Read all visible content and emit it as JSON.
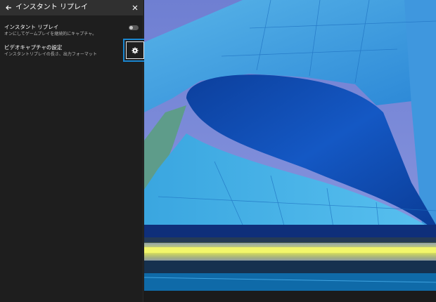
{
  "header": {
    "back_icon": "back-arrow-icon",
    "title": "インスタント リプレイ",
    "close_icon": "close-icon"
  },
  "settings": {
    "instant_replay": {
      "label": "インスタント リプレイ",
      "description": "オンにしてゲームプレイを継続的にキャプチャ。",
      "toggle_on": false
    },
    "video_capture": {
      "label": "ビデオキャプチャの設定",
      "description": "インスタントリプレイの長さ、出力フォーマット",
      "icon": "gear-icon"
    }
  },
  "colors": {
    "panel_bg": "#1e1e1e",
    "titlebar_bg": "#303030",
    "focus_accent": "#1a86d0"
  }
}
